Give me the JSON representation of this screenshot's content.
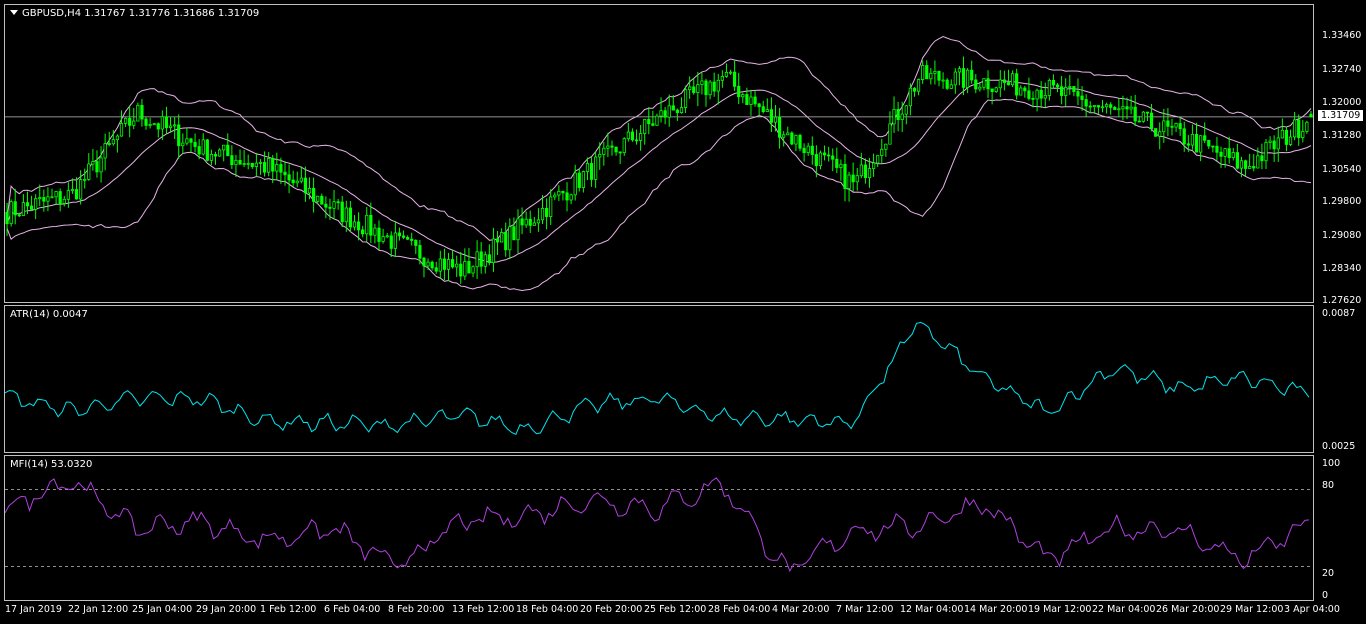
{
  "main": {
    "label": "GBPUSD,H4  1.31767 1.31776 1.31686 1.31709",
    "current_price": "1.31709",
    "y_ticks": [
      "1.33460",
      "1.32740",
      "1.32000",
      "1.31280",
      "1.30540",
      "1.29800",
      "1.29080",
      "1.28340",
      "1.27620"
    ],
    "colors": {
      "candle": "#00ff00",
      "bands": "#e6b3e6",
      "price_line": "#c0c0c0"
    }
  },
  "atr": {
    "label": "ATR(14) 0.0047",
    "y_ticks": [
      "0.0087",
      "0.0025"
    ],
    "color": "#00e5ee"
  },
  "mfi": {
    "label": "MFI(14) 53.0320",
    "y_ticks": [
      "100",
      "80",
      "20",
      "0"
    ],
    "color": "#b040e0"
  },
  "x_axis": [
    "17 Jan 2019",
    "22 Jan 12:00",
    "25 Jan 04:00",
    "29 Jan 20:00",
    "1 Feb 12:00",
    "6 Feb 04:00",
    "8 Feb 20:00",
    "13 Feb 12:00",
    "18 Feb 04:00",
    "20 Feb 20:00",
    "25 Feb 12:00",
    "28 Feb 04:00",
    "4 Mar 20:00",
    "7 Mar 12:00",
    "12 Mar 04:00",
    "14 Mar 20:00",
    "19 Mar 12:00",
    "22 Mar 04:00",
    "26 Mar 20:00",
    "29 Mar 12:00",
    "3 Apr 04:00"
  ],
  "chart_data": [
    {
      "type": "candlestick",
      "symbol": "GBPUSD",
      "timeframe": "H4",
      "ohlc": {
        "open": 1.31767,
        "high": 1.31776,
        "low": 1.31686,
        "close": 1.31709
      },
      "ylim": [
        1.2762,
        1.3418
      ],
      "indicator": "Bollinger Bands",
      "approx_close_path": [
        [
          "17 Jan 2019",
          1.296
        ],
        [
          "22 Jan 12:00",
          1.3
        ],
        [
          "25 Jan 04:00",
          1.318
        ],
        [
          "29 Jan 20:00",
          1.31
        ],
        [
          "1 Feb 12:00",
          1.306
        ],
        [
          "6 Feb 04:00",
          1.297
        ],
        [
          "8 Feb 20:00",
          1.289
        ],
        [
          "13 Feb 12:00",
          1.283
        ],
        [
          "18 Feb 04:00",
          1.294
        ],
        [
          "20 Feb 20:00",
          1.306
        ],
        [
          "25 Feb 12:00",
          1.317
        ],
        [
          "28 Feb 04:00",
          1.326
        ],
        [
          "4 Mar 20:00",
          1.313
        ],
        [
          "7 Mar 12:00",
          1.302
        ],
        [
          "12 Mar 04:00",
          1.326
        ],
        [
          "14 Mar 20:00",
          1.325
        ],
        [
          "19 Mar 12:00",
          1.323
        ],
        [
          "22 Mar 04:00",
          1.318
        ],
        [
          "26 Mar 20:00",
          1.313
        ],
        [
          "29 Mar 12:00",
          1.306
        ],
        [
          "3 Apr 04:00",
          1.3171
        ]
      ]
    },
    {
      "type": "line",
      "name": "ATR(14)",
      "ylim": [
        0.0019,
        0.009
      ],
      "approx_values": [
        [
          "17 Jan 2019",
          0.0046
        ],
        [
          "22 Jan 12:00",
          0.0039
        ],
        [
          "25 Jan 04:00",
          0.0045
        ],
        [
          "29 Jan 20:00",
          0.0045
        ],
        [
          "1 Feb 12:00",
          0.0034
        ],
        [
          "6 Feb 04:00",
          0.0033
        ],
        [
          "8 Feb 20:00",
          0.0032
        ],
        [
          "13 Feb 12:00",
          0.0037
        ],
        [
          "18 Feb 04:00",
          0.003
        ],
        [
          "20 Feb 20:00",
          0.0042
        ],
        [
          "25 Feb 12:00",
          0.0045
        ],
        [
          "28 Feb 04:00",
          0.0036
        ],
        [
          "4 Mar 20:00",
          0.0035
        ],
        [
          "7 Mar 12:00",
          0.0033
        ],
        [
          "12 Mar 04:00",
          0.0082
        ],
        [
          "14 Mar 20:00",
          0.0055
        ],
        [
          "19 Mar 12:00",
          0.0038
        ],
        [
          "22 Mar 04:00",
          0.006
        ],
        [
          "26 Mar 20:00",
          0.005
        ],
        [
          "29 Mar 12:00",
          0.0055
        ],
        [
          "3 Apr 04:00",
          0.0047
        ]
      ]
    },
    {
      "type": "line",
      "name": "MFI(14)",
      "ylim": [
        0,
        100
      ],
      "levels": [
        20,
        80
      ],
      "approx_values": [
        [
          "17 Jan 2019",
          65
        ],
        [
          "22 Jan 12:00",
          88
        ],
        [
          "25 Jan 04:00",
          50
        ],
        [
          "29 Jan 20:00",
          55
        ],
        [
          "1 Feb 12:00",
          40
        ],
        [
          "6 Feb 04:00",
          50
        ],
        [
          "8 Feb 20:00",
          20
        ],
        [
          "13 Feb 12:00",
          55
        ],
        [
          "18 Feb 04:00",
          60
        ],
        [
          "20 Feb 20:00",
          72
        ],
        [
          "25 Feb 12:00",
          65
        ],
        [
          "28 Feb 04:00",
          85
        ],
        [
          "4 Mar 20:00",
          15
        ],
        [
          "7 Mar 12:00",
          48
        ],
        [
          "12 Mar 04:00",
          52
        ],
        [
          "14 Mar 20:00",
          70
        ],
        [
          "19 Mar 12:00",
          25
        ],
        [
          "22 Mar 04:00",
          50
        ],
        [
          "26 Mar 20:00",
          48
        ],
        [
          "29 Mar 12:00",
          25
        ],
        [
          "3 Apr 04:00",
          53
        ]
      ]
    }
  ]
}
